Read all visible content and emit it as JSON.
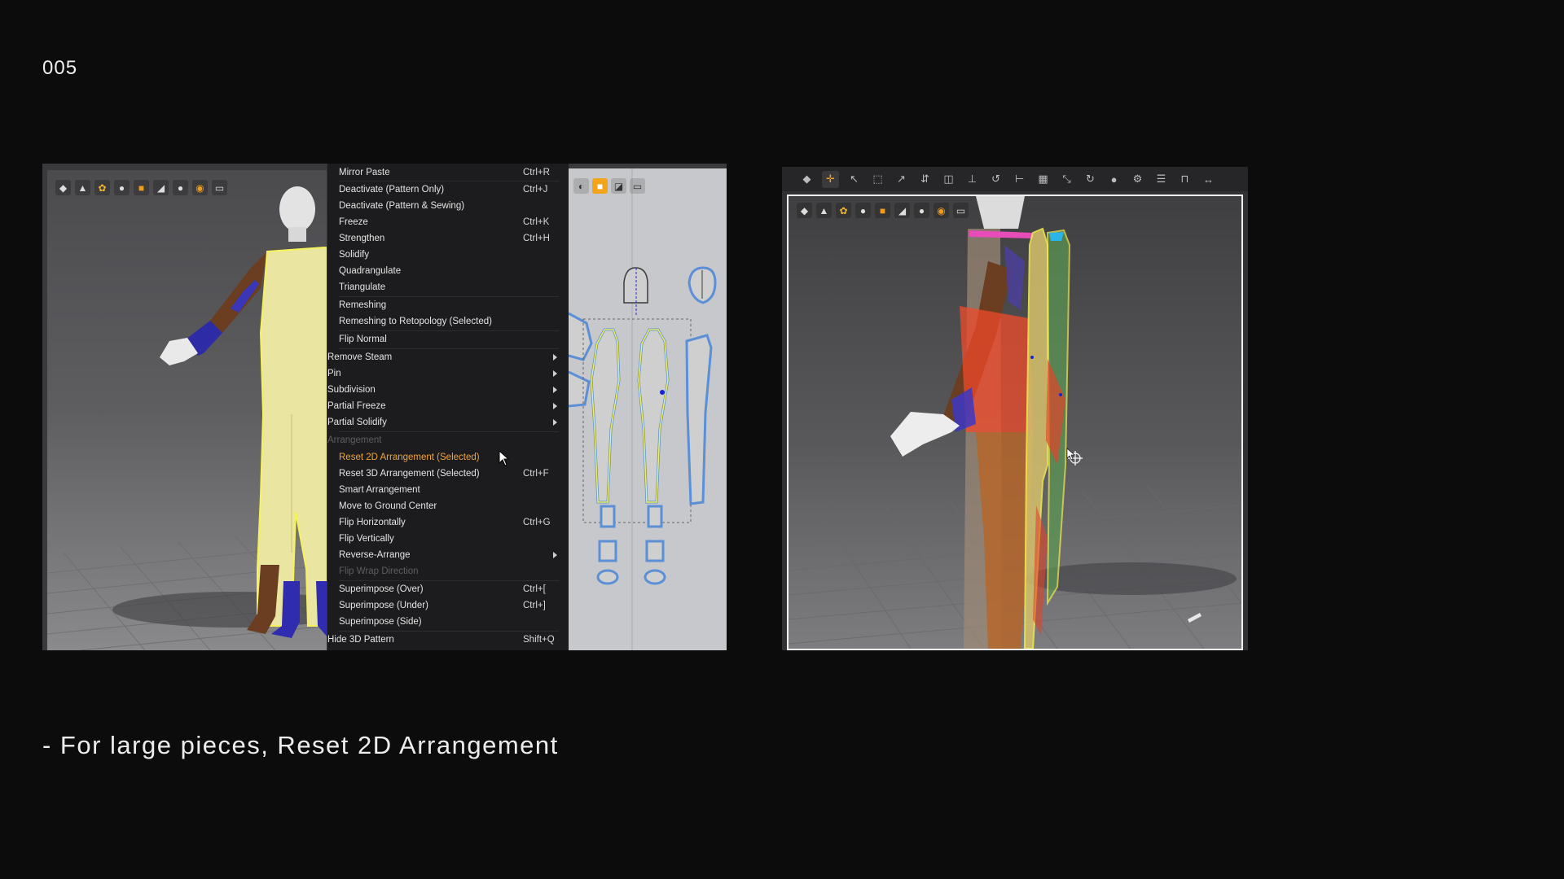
{
  "slide": {
    "number": "005"
  },
  "caption": "- For large pieces, Reset 2D Arrangement",
  "left_screenshot": {
    "viewport_toolbar": [
      {
        "name": "garment-icon",
        "glyph": "◆"
      },
      {
        "name": "shirt-icon",
        "glyph": "▲"
      },
      {
        "name": "sewing-icon",
        "glyph": "✿",
        "tone": "gold"
      },
      {
        "name": "avatar-icon",
        "glyph": "●"
      },
      {
        "name": "fabric-icon",
        "glyph": "■",
        "tone": "orange"
      },
      {
        "name": "shoe-icon",
        "glyph": "◢"
      },
      {
        "name": "head-icon",
        "glyph": "●"
      },
      {
        "name": "ball-icon",
        "glyph": "◉",
        "tone": "orange"
      },
      {
        "name": "export-icon",
        "glyph": "▭"
      }
    ],
    "context_menu": [
      {
        "label": "Mirror Paste",
        "shortcut": "Ctrl+R",
        "indent": true
      },
      {
        "label": "Deactivate (Pattern Only)",
        "shortcut": "Ctrl+J",
        "indent": true
      },
      {
        "label": "Deactivate (Pattern & Sewing)",
        "shortcut": "",
        "indent": true
      },
      {
        "label": "Freeze",
        "shortcut": "Ctrl+K",
        "indent": true
      },
      {
        "label": "Strengthen",
        "shortcut": "Ctrl+H",
        "indent": true
      },
      {
        "label": "Solidify",
        "shortcut": "",
        "indent": true
      },
      {
        "label": "Quadrangulate",
        "shortcut": "",
        "indent": true
      },
      {
        "label": "Triangulate",
        "shortcut": "",
        "indent": true
      },
      {
        "label": "Remeshing",
        "shortcut": "",
        "indent": true
      },
      {
        "label": "Remeshing to Retopology (Selected)",
        "shortcut": "",
        "indent": true
      },
      {
        "label": "Flip Normal",
        "shortcut": "",
        "indent": true
      },
      {
        "label": "Remove Steam",
        "shortcut": "",
        "indent": false,
        "submenu": true
      },
      {
        "label": "Pin",
        "shortcut": "",
        "indent": false,
        "submenu": true
      },
      {
        "label": "Subdivision",
        "shortcut": "",
        "indent": false,
        "submenu": true
      },
      {
        "label": "Partial Freeze",
        "shortcut": "",
        "indent": false,
        "submenu": true
      },
      {
        "label": "Partial Solidify",
        "shortcut": "",
        "indent": false,
        "submenu": true
      },
      {
        "label": "Arrangement",
        "shortcut": "",
        "indent": false,
        "disabled": true
      },
      {
        "label": "Reset 2D Arrangement (Selected)",
        "shortcut": "",
        "indent": true,
        "highlight": true
      },
      {
        "label": "Reset 3D Arrangement (Selected)",
        "shortcut": "Ctrl+F",
        "indent": true
      },
      {
        "label": "Smart Arrangement",
        "shortcut": "",
        "indent": true
      },
      {
        "label": "Move to Ground Center",
        "shortcut": "",
        "indent": true
      },
      {
        "label": "Flip Horizontally",
        "shortcut": "Ctrl+G",
        "indent": true
      },
      {
        "label": "Flip Vertically",
        "shortcut": "",
        "indent": true
      },
      {
        "label": "Reverse-Arrange",
        "shortcut": "",
        "indent": true,
        "submenu": true
      },
      {
        "label": "Flip Wrap Direction",
        "shortcut": "",
        "indent": true,
        "disabled": true
      },
      {
        "label": "Superimpose (Over)",
        "shortcut": "Ctrl+[",
        "indent": true
      },
      {
        "label": "Superimpose (Under)",
        "shortcut": "Ctrl+]",
        "indent": true
      },
      {
        "label": "Superimpose (Side)",
        "shortcut": "",
        "indent": true
      },
      {
        "label": "Hide 3D Pattern",
        "shortcut": "Shift+Q",
        "indent": false
      }
    ],
    "pattern_toolbar": [
      {
        "name": "segment-icon",
        "glyph": "◐"
      },
      {
        "name": "fabric-swatch-icon",
        "glyph": "■",
        "tone": "orange"
      },
      {
        "name": "trim-icon",
        "glyph": "◪"
      },
      {
        "name": "export-icon",
        "glyph": "▭"
      }
    ]
  },
  "right_screenshot": {
    "top_toolbar": [
      {
        "name": "select-icon",
        "glyph": "◆"
      },
      {
        "name": "move-icon",
        "glyph": "✛",
        "active": true
      },
      {
        "name": "edit-point-icon",
        "glyph": "↖"
      },
      {
        "name": "transform-icon",
        "glyph": "⬚"
      },
      {
        "name": "curve-icon",
        "glyph": "↗"
      },
      {
        "name": "sew-icon",
        "glyph": "⇵"
      },
      {
        "name": "fold-icon",
        "glyph": "◫"
      },
      {
        "name": "pin-icon",
        "glyph": "⊥"
      },
      {
        "name": "tack-icon",
        "glyph": "↺"
      },
      {
        "name": "measure-icon",
        "glyph": "⊢"
      },
      {
        "name": "grid-icon",
        "glyph": "▦"
      },
      {
        "name": "tape-icon",
        "glyph": "⤡"
      },
      {
        "name": "rotate-icon",
        "glyph": "↻"
      },
      {
        "name": "button-icon",
        "glyph": "●"
      },
      {
        "name": "zipper-icon",
        "glyph": "⚙"
      },
      {
        "name": "align-icon",
        "glyph": "☰"
      },
      {
        "name": "arrange-icon",
        "glyph": "⊓"
      },
      {
        "name": "fit-icon",
        "glyph": "↔"
      }
    ],
    "viewport_toolbar": [
      {
        "name": "garment-icon",
        "glyph": "◆"
      },
      {
        "name": "shirt-icon",
        "glyph": "▲"
      },
      {
        "name": "sewing-icon",
        "glyph": "✿",
        "tone": "gold"
      },
      {
        "name": "avatar-icon",
        "glyph": "●"
      },
      {
        "name": "fabric-icon",
        "glyph": "■",
        "tone": "orange"
      },
      {
        "name": "shoe-icon",
        "glyph": "◢"
      },
      {
        "name": "head-icon",
        "glyph": "●"
      },
      {
        "name": "ball-icon",
        "glyph": "◉",
        "tone": "orange"
      },
      {
        "name": "export-icon",
        "glyph": "▭"
      }
    ]
  }
}
